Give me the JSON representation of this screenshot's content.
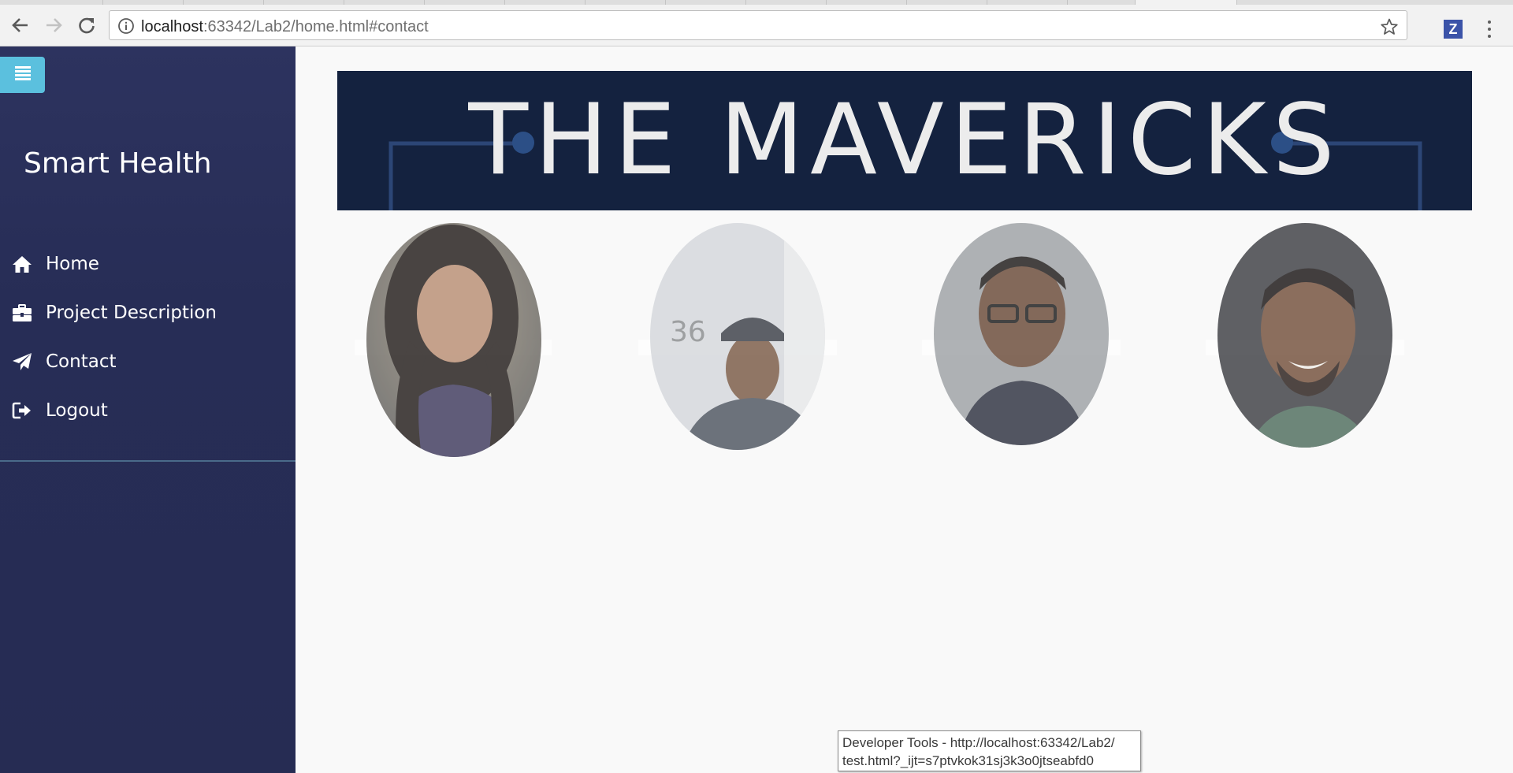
{
  "browser": {
    "url_host": "localhost",
    "url_rest": ":63342/Lab2/home.html#contact",
    "back_icon": "arrow-left-icon",
    "forward_icon": "arrow-right-icon",
    "reload_icon": "reload-icon",
    "info_icon": "info-icon",
    "bookmark_icon": "star-icon",
    "extension_label": "Z",
    "extension_color": "#3b53a8"
  },
  "sidebar": {
    "toggle_icon": "list-icon",
    "toggle_color": "#5bc0de",
    "brand": "Smart Health",
    "items": [
      {
        "label": "Home",
        "icon": "home-icon"
      },
      {
        "label": "Project Description",
        "icon": "briefcase-icon"
      },
      {
        "label": "Contact",
        "icon": "paper-plane-icon"
      },
      {
        "label": "Logout",
        "icon": "logout-icon"
      }
    ],
    "background": "#272d56"
  },
  "main": {
    "banner_title": "THE MAVERICKS",
    "banner_color": "#14223f",
    "team_photos": [
      {
        "name": "team-member-1-photo"
      },
      {
        "name": "team-member-2-photo"
      },
      {
        "name": "team-member-3-photo"
      },
      {
        "name": "team-member-4-photo"
      }
    ]
  },
  "tooltip": {
    "line1": "Developer Tools - http://localhost:63342/Lab2/",
    "line2": "test.html?_ijt=s7ptvkok31sj3k3o0jtseabfd0"
  }
}
